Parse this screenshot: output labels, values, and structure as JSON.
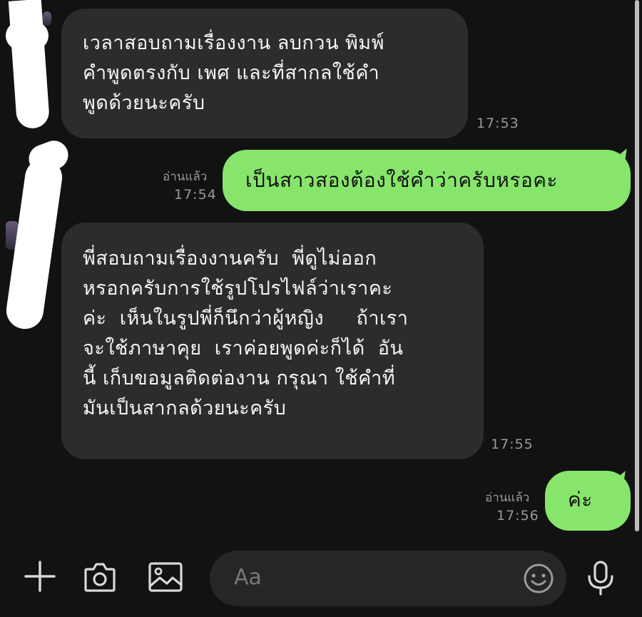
{
  "messages": [
    {
      "direction": "incoming",
      "lines": [
        "เวลาสอบถามเรื่องงาน ลบกวน พิมพ์",
        "คำพูดตรงกับ เพศ และที่สากลใช้คำ",
        "พูดด้วยนะครับ"
      ],
      "time": "17:53"
    },
    {
      "direction": "outgoing",
      "lines": [
        "เป็นสาวสองต้องใช้คำว่าครับหรอคะ"
      ],
      "read": "อ่านแล้ว",
      "time": "17:54"
    },
    {
      "direction": "incoming",
      "lines": [
        "พี่สอบถามเรื่องงานครับ  พี่ดูไม่ออก",
        "หรอกครับการใช้รูปโปรไฟล์ว่าเราคะ",
        "ค่ะ  เห็นในรูปพี่ก็นึกว่าผู้หญิง     ถ้าเรา",
        "จะใช้ภาษาคุย  เราค่อยพูดค่ะก็ได้  อัน",
        "นี้ เก็บขอมูลติดต่องาน กรุณา ใช้คำที่",
        "มันเป็นสากลด้วยนะครับ"
      ],
      "time": "17:55"
    },
    {
      "direction": "outgoing",
      "lines": [
        "ค่ะ"
      ],
      "read": "อ่านแล้ว",
      "time": "17:56"
    }
  ],
  "input": {
    "placeholder": "Aa"
  },
  "icons": {
    "add": "plus-icon",
    "camera": "camera-icon",
    "gallery": "image-icon",
    "emoji": "emoji-icon",
    "voice": "microphone-icon"
  },
  "colors": {
    "background": "#121212",
    "incoming_bubble": "#2c2c2c",
    "outgoing_bubble": "#87e56b",
    "meta_text": "#9a9a9a"
  }
}
